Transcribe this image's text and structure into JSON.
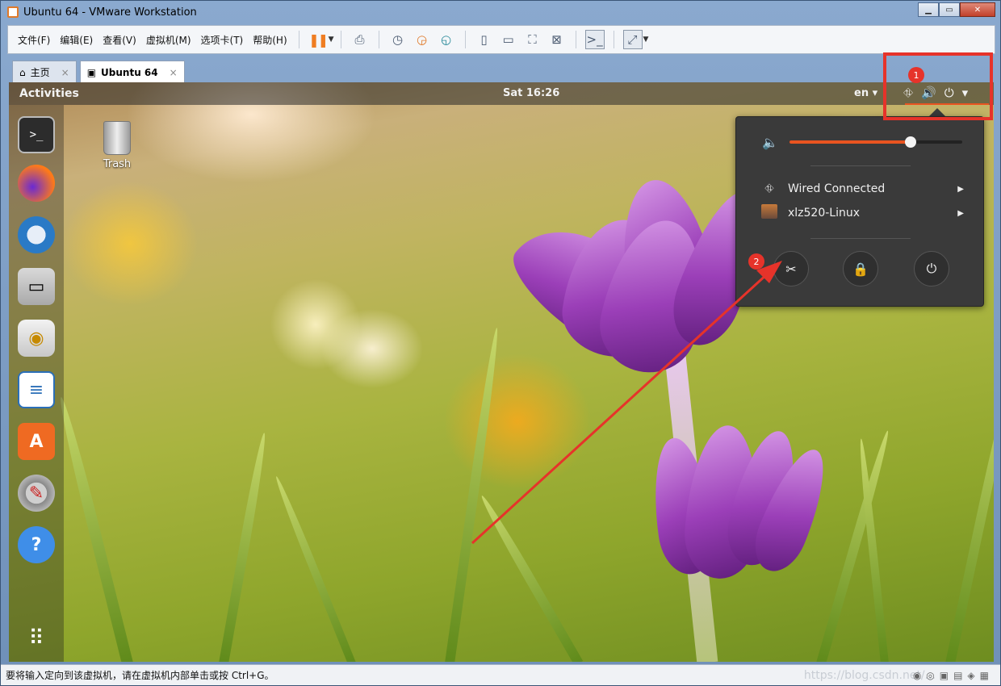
{
  "window": {
    "title": "Ubuntu 64 - VMware Workstation",
    "controls": {
      "minimize": "▁",
      "maximize": "▭",
      "close": "✕"
    }
  },
  "menubar": {
    "items": [
      "文件(F)",
      "编辑(E)",
      "查看(V)",
      "虚拟机(M)",
      "选项卡(T)",
      "帮助(H)"
    ],
    "toolbar_icons": [
      "pause-icon",
      "send-keys-icon",
      "snapshot-icon",
      "revert-snapshot-icon",
      "snapshot-manager-icon",
      "sidebar-view-icon",
      "thumbnail-view-icon",
      "fullscreen-icon",
      "unity-icon",
      "console-icon",
      "stretch-icon"
    ]
  },
  "tabs": [
    {
      "label": "主页",
      "icon": "home-icon"
    },
    {
      "label": "Ubuntu 64",
      "icon": "vm-icon",
      "active": true
    }
  ],
  "guest": {
    "activities": "Activities",
    "clock": "Sat 16:26",
    "lang": "en ▾",
    "sys_caret": "▾",
    "trash_label": "Trash",
    "dock": [
      "terminal",
      "firefox",
      "thunderbird",
      "files",
      "rhythmbox",
      "libreoffice-writer",
      "ubuntu-software",
      "settings",
      "help",
      "show-applications"
    ],
    "popup": {
      "volume_level": 0.7,
      "wired": "Wired Connected",
      "user": "xlz520-Linux",
      "buttons": [
        "settings-icon",
        "lock-icon",
        "power-icon"
      ]
    }
  },
  "annotations": {
    "badge1": "1",
    "badge2": "2",
    "color": "#e6332a"
  },
  "status": {
    "text": "要将输入定向到该虚拟机，请在虚拟机内部单击或按 Ctrl+G。",
    "watermark": "https://blog.csdn.net/..."
  }
}
